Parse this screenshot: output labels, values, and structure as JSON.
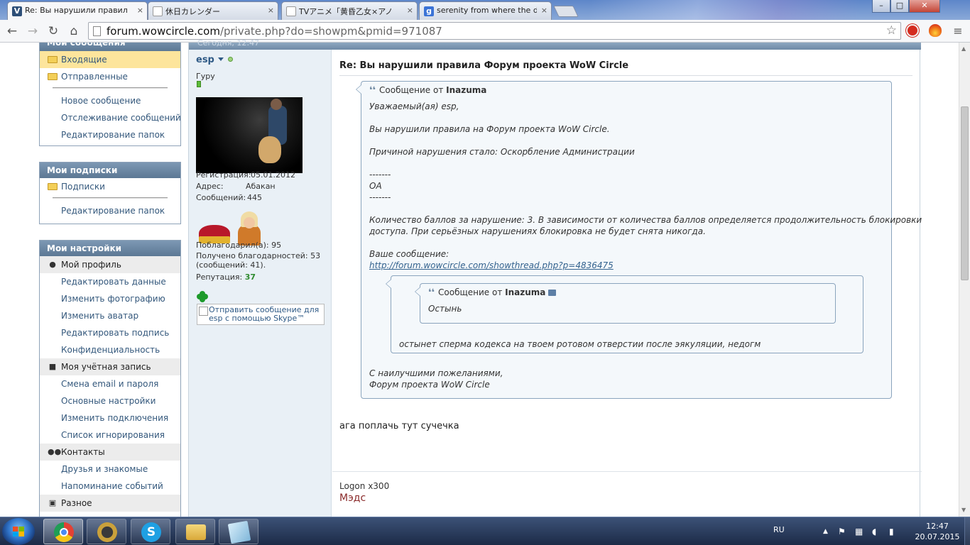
{
  "browser": {
    "tabs": [
      {
        "title": "Re: Вы нарушили правил",
        "close": "×",
        "favicon_color": "#2d4f78",
        "active": true
      },
      {
        "title": "休日カレンダー",
        "close": "×",
        "favicon_color": "#ffffff",
        "active": false
      },
      {
        "title": "TVアニメ「黄昏乙女×アノ",
        "close": "×",
        "favicon_color": "#ffffff",
        "active": false
      },
      {
        "title": "serenity from where the d",
        "close": "×",
        "favicon_color": "#3b73d6",
        "active": false
      }
    ],
    "window_controls": {
      "minimize": "–",
      "maximize": "□",
      "close": "✕"
    },
    "nav": {
      "back": "←",
      "forward": "→",
      "reload": "↻",
      "home": "⌂"
    },
    "address": {
      "host": "forum.wowcircle.com",
      "path": "/private.php?do=showpm&pmid=971087"
    },
    "bookmark_star": "☆",
    "menu": "≡"
  },
  "sidebar": {
    "partial_header": "Мои сообщения",
    "folders": [
      {
        "label": "Входящие",
        "selected": true
      },
      {
        "label": "Отправленные",
        "selected": false
      }
    ],
    "folder_links": [
      "Новое сообщение",
      "Отслеживание сообщений",
      "Редактирование папок"
    ],
    "subscriptions": {
      "title": "Мои подписки",
      "folder": "Подписки",
      "links": [
        "Редактирование папок"
      ]
    },
    "settings": {
      "title": "Мои настройки",
      "groups": [
        {
          "label": "Мой профиль",
          "icon": "person-icon",
          "glyph": "●",
          "items": [
            "Редактировать данные",
            "Изменить фотографию",
            "Изменить аватар",
            "Редактировать подпись",
            "Конфиденциальность"
          ]
        },
        {
          "label": "Моя учётная запись",
          "icon": "lock-icon",
          "glyph": "■",
          "items": [
            "Смена email и пароля",
            "Основные настройки",
            "Изменить подключения",
            "Список игнорирования"
          ]
        },
        {
          "label": "Контакты",
          "icon": "contacts-icon",
          "glyph": "●●",
          "items": [
            "Друзья и знакомые",
            "Напоминание событий"
          ]
        },
        {
          "label": "Разное",
          "icon": "misc-icon",
          "glyph": "▣",
          "items": []
        }
      ]
    }
  },
  "post": {
    "date_partial": "Сегодня, 12:47",
    "user": {
      "name": "esp",
      "title": "Гуру",
      "reg_label": "Регистрация:",
      "reg_value": "05.01.2012",
      "addr_label": "Адрес:",
      "addr_value": "Абакан",
      "posts_label": "Сообщений:",
      "posts_value": "445",
      "thanks_given": "Поблагодарил(а):    95",
      "thanks_recv_1": "Получено благодарностей: 53",
      "thanks_recv_2": "(сообщений: 41).",
      "rep_label": "Репутация:",
      "rep_value": "37",
      "skype_alt": "Отправить сообщение для esp с помощью Skype™"
    },
    "title": "Re: Вы нарушили правила Форум проекта WoW Circle",
    "quote_prefix": "Сообщение от",
    "quote": {
      "author": "Inazuma",
      "lines": [
        "Уважаемый(ая) esp,",
        "Вы нарушили правила на Форум проекта WoW Circle.",
        "Причиной нарушения стало: Оскорбление Администрации",
        "-------",
        "ОА",
        "-------",
        "Количество баллов за нарушение: 3. В зависимости от количества баллов определяется продолжительность блокировки",
        "доступа. При серьёзных нарушениях блокировка не будет снята никогда.",
        "Ваше сообщение:"
      ],
      "link": "http://forum.wowcircle.com/showthread.php?p=4836475",
      "closing": [
        "С наилучшими пожеланиями,",
        "Форум проекта WoW Circle"
      ]
    },
    "quote_mid": {
      "text": "остынет сперма кодекса на твоем ротовом отверстии после эякуляции, недогм"
    },
    "quote_inner": {
      "author": "Inazuma",
      "text": "Остынь"
    },
    "reply": "ага поплачь тут сучечка",
    "signature": {
      "line1": "Logon x300",
      "line2": "Мэдс"
    }
  },
  "taskbar": {
    "apps": [
      {
        "name": "chrome",
        "color": "#e44134"
      },
      {
        "name": "warcraft",
        "color": "#caa13b"
      },
      {
        "name": "skype",
        "color": "#1fa0e3"
      },
      {
        "name": "explorer",
        "color": "#e7c35b"
      },
      {
        "name": "notepad",
        "color": "#a9d3ec"
      }
    ],
    "lang": "RU",
    "time": "12:47",
    "date": "20.07.2015"
  }
}
